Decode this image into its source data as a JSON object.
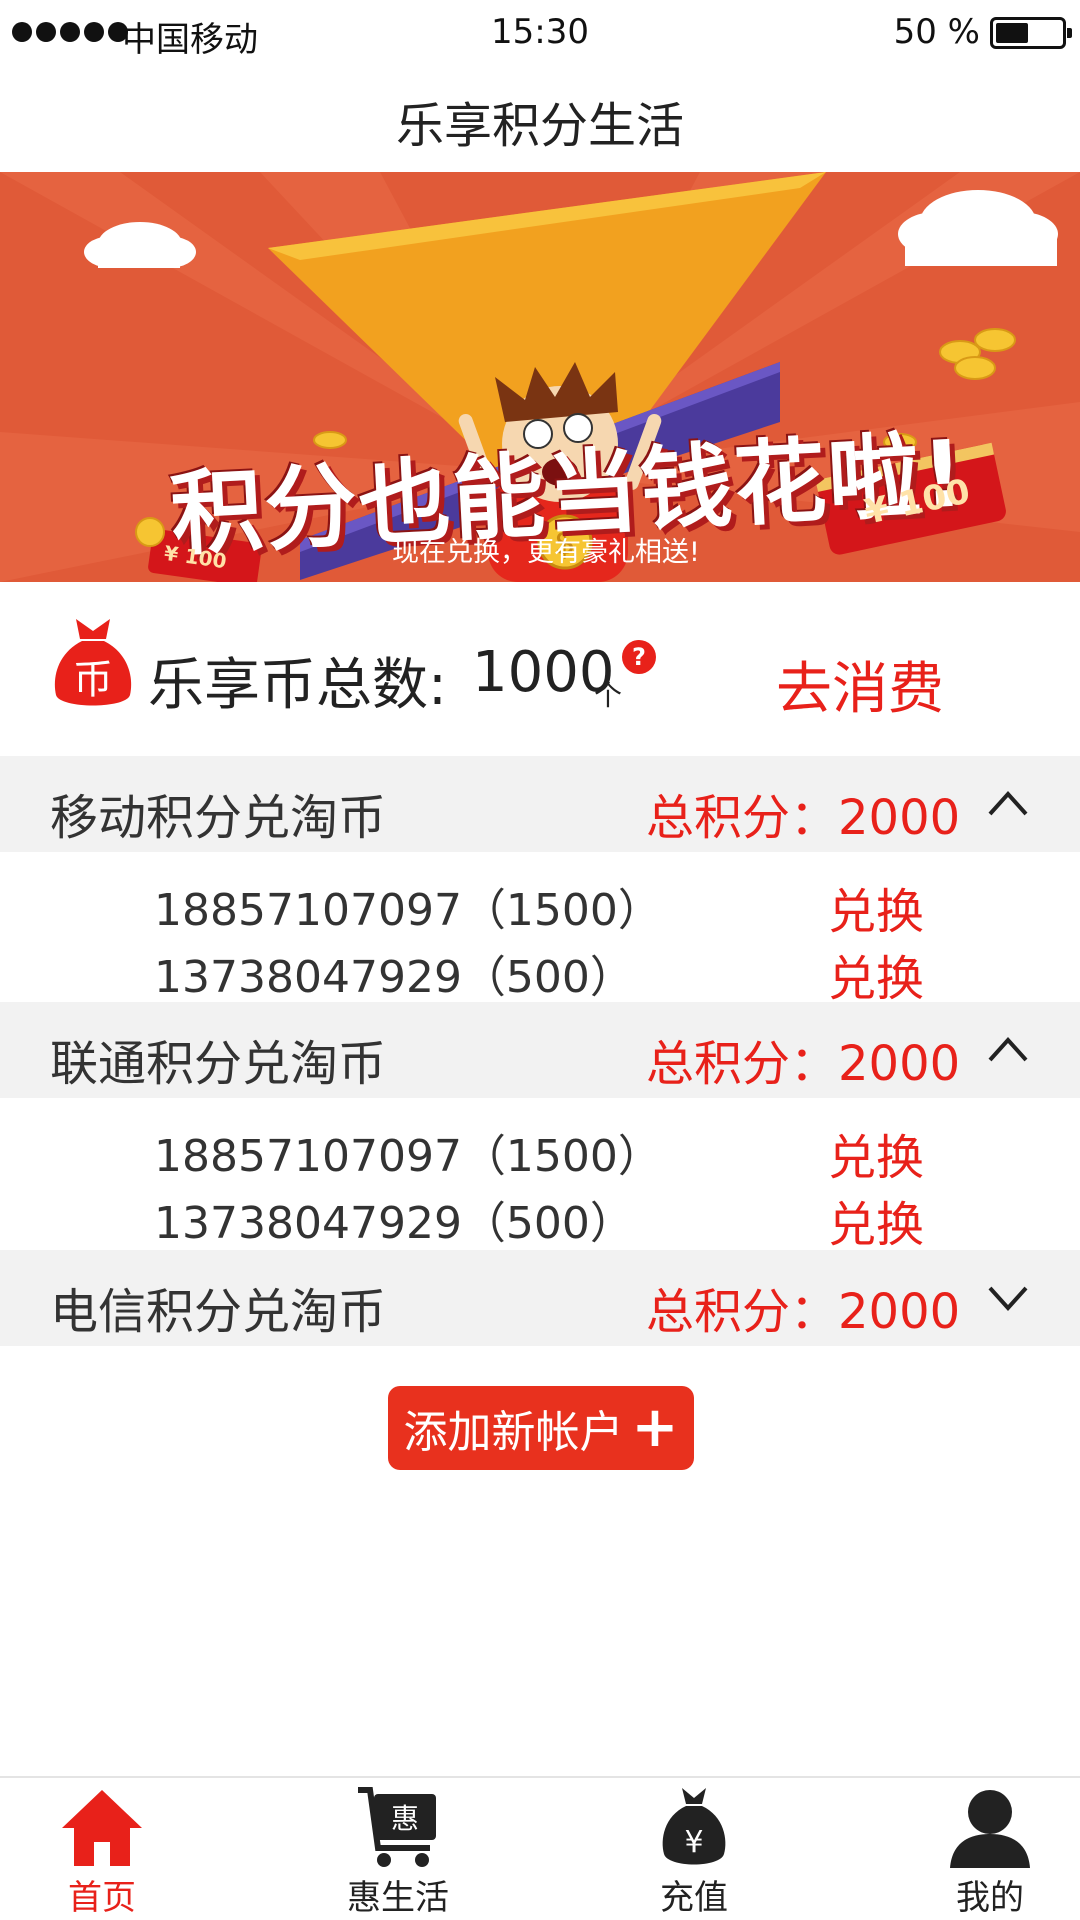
{
  "status_bar": {
    "carrier": "中国移动",
    "time": "15:30",
    "battery_percent": "50 %",
    "battery_level": 0.5
  },
  "nav": {
    "title": "乐享积分生活"
  },
  "banner": {
    "headline": "积分也能当钱花啦!",
    "subtitle": "现在兑换，更有豪礼相送!",
    "red_packet_amount": "¥ 100"
  },
  "summary": {
    "label": "乐享币总数:",
    "value": "1000",
    "unit": "个",
    "help_glyph": "?",
    "spend_link": "去消费"
  },
  "sections": [
    {
      "title": "移动积分兑淘币",
      "total": "总积分：2000",
      "expanded": true,
      "accounts": [
        {
          "text": "18857107097（1500）",
          "action": "兑换"
        },
        {
          "text": "13738047929（500）",
          "action": "兑换"
        }
      ]
    },
    {
      "title": "联通积分兑淘币",
      "total": "总积分：2000",
      "expanded": true,
      "accounts": [
        {
          "text": "18857107097（1500）",
          "action": "兑换"
        },
        {
          "text": "13738047929（500）",
          "action": "兑换"
        }
      ]
    },
    {
      "title": "电信积分兑淘币",
      "total": "总积分：2000",
      "expanded": false,
      "accounts": []
    }
  ],
  "add_account": {
    "label": "添加新帐户",
    "plus": "+"
  },
  "tab_bar": {
    "items": [
      {
        "label": "首页",
        "icon": "home-icon",
        "active": true
      },
      {
        "label": "惠生活",
        "icon": "cart-icon",
        "active": false
      },
      {
        "label": "充值",
        "icon": "money-bag-icon",
        "active": false
      },
      {
        "label": "我的",
        "icon": "user-icon",
        "active": false
      }
    ]
  },
  "colors": {
    "accent_red": "#e8211a",
    "banner_bg": "#e05a38",
    "section_bg": "#f2f2f2"
  }
}
